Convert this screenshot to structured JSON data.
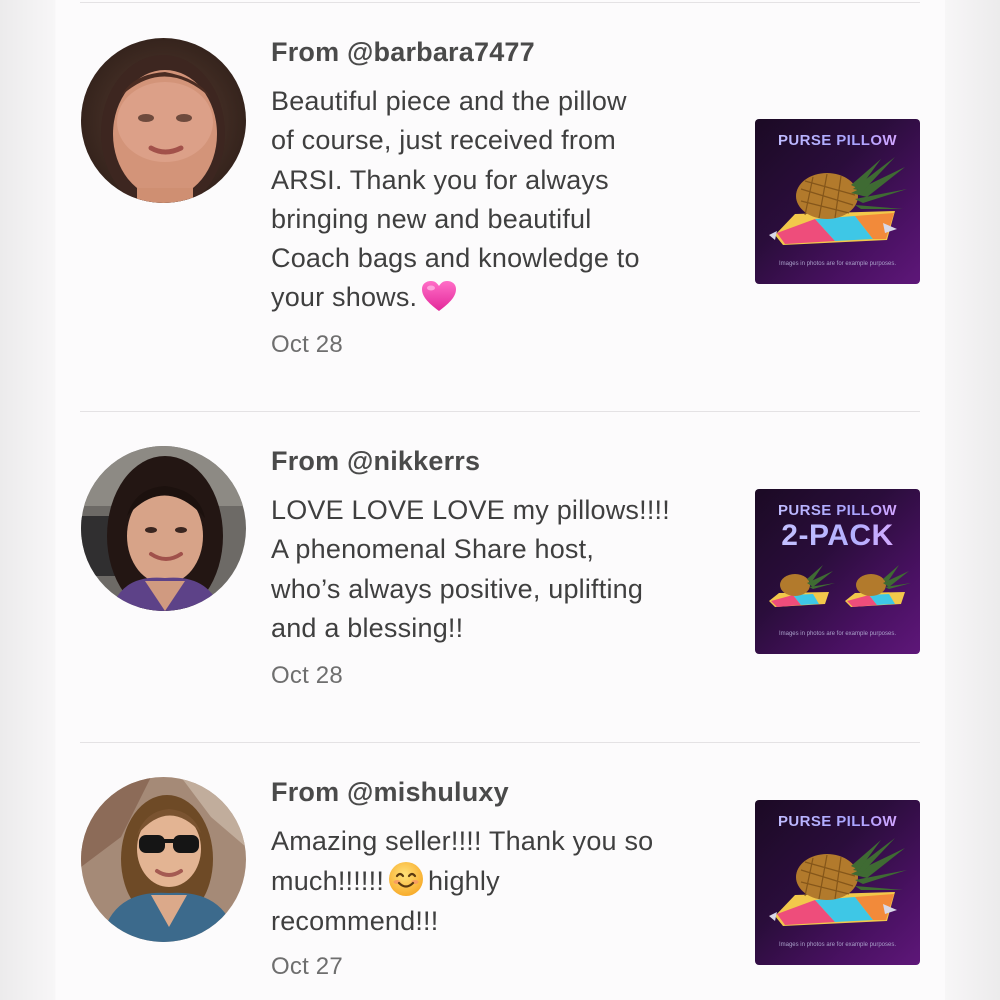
{
  "reviews": [
    {
      "from": "From @barbara7477",
      "lines": [
        "Beautiful piece and the pillow",
        "of course, just received from",
        "ARSI. Thank you for always",
        "bringing new and beautiful",
        "Coach bags and knowledge to",
        "your shows."
      ],
      "emoji": "heart-emoji",
      "date": "Oct 28",
      "product": {
        "title": "PURSE PILLOW",
        "subtitle": "",
        "note": "Images in photos are for example purposes."
      }
    },
    {
      "from": "From @nikkerrs",
      "lines": [
        "LOVE LOVE LOVE my pillows!!!!",
        "A phenomenal Share host,",
        "who’s always positive, uplifting",
        "and a blessing!!"
      ],
      "date": "Oct 28",
      "product": {
        "title": "PURSE PILLOW",
        "subtitle": "2-PACK",
        "note": "Images in photos are for example purposes."
      }
    },
    {
      "from": "From @mishuluxy",
      "lines": [
        "Amazing seller!!!! Thank you so",
        "much!!!!!!",
        "highly",
        "recommend!!!"
      ],
      "emoji": "smiling-face-emoji",
      "date": "Oct 27",
      "product": {
        "title": "PURSE PILLOW",
        "subtitle": "",
        "note": "Images in photos are for example purposes."
      }
    }
  ],
  "colors": {
    "text": "#3f3f3f",
    "username": "#4a4a4a",
    "date": "#6e6e6e",
    "product_bg": "#2a0d3b",
    "product_title": "#b7b3ff"
  }
}
